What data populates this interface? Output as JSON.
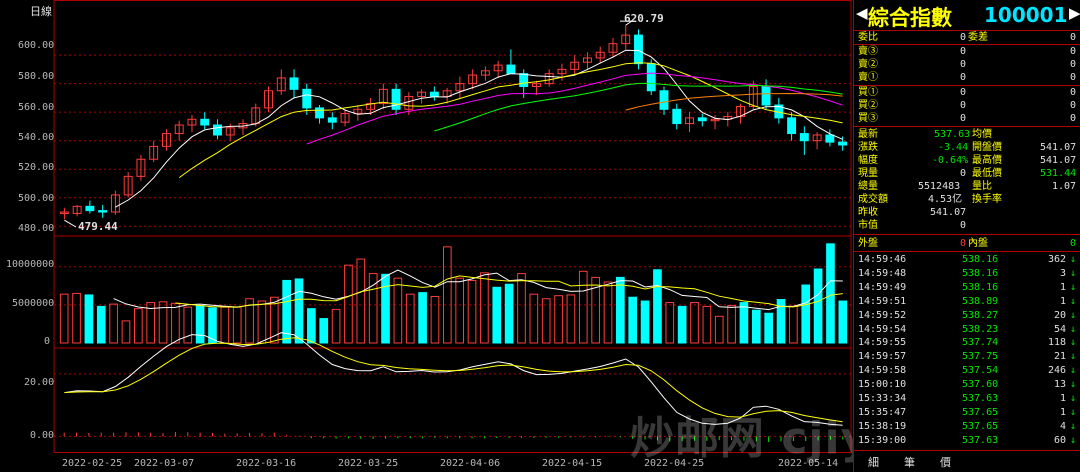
{
  "chart": {
    "period_label": "日線",
    "price_axis_ticks": [
      "600.00",
      "580.00",
      "560.00",
      "540.00",
      "520.00",
      "500.00",
      "480.00"
    ],
    "high_label": "620.79",
    "low_label": "479.44",
    "volume_axis_ticks": [
      "10000000",
      "5000000",
      "0"
    ],
    "indicator_axis_ticks": [
      "20.00",
      "0.00"
    ],
    "date_labels": [
      "2022-02-25",
      "2022-03-07",
      "2022-03-16",
      "2022-03-25",
      "2022-04-06",
      "2022-04-15",
      "2022-04-25",
      "2022-05-14"
    ]
  },
  "chart_data": {
    "type": "candlestick",
    "price_range": [
      476,
      626
    ],
    "candles": [
      [
        489,
        493,
        485,
        490
      ],
      [
        489,
        495,
        487,
        494
      ],
      [
        494,
        498,
        489,
        491
      ],
      [
        491,
        495,
        486,
        490
      ],
      [
        490,
        505,
        488,
        502
      ],
      [
        502,
        518,
        500,
        515
      ],
      [
        515,
        530,
        512,
        527
      ],
      [
        527,
        540,
        525,
        536
      ],
      [
        536,
        548,
        533,
        545
      ],
      [
        545,
        554,
        540,
        551
      ],
      [
        551,
        558,
        546,
        555
      ],
      [
        555,
        560,
        548,
        551
      ],
      [
        551,
        555,
        541,
        544
      ],
      [
        544,
        552,
        540,
        549
      ],
      [
        549,
        555,
        544,
        552
      ],
      [
        552,
        566,
        550,
        563
      ],
      [
        563,
        578,
        560,
        575
      ],
      [
        575,
        590,
        572,
        584
      ],
      [
        584,
        590,
        570,
        576
      ],
      [
        576,
        580,
        558,
        563
      ],
      [
        563,
        565,
        552,
        556
      ],
      [
        556,
        560,
        548,
        553
      ],
      [
        553,
        562,
        550,
        559
      ],
      [
        559,
        565,
        554,
        562
      ],
      [
        562,
        570,
        558,
        566
      ],
      [
        566,
        580,
        562,
        576
      ],
      [
        576,
        580,
        558,
        562
      ],
      [
        562,
        574,
        558,
        571
      ],
      [
        571,
        576,
        566,
        574
      ],
      [
        574,
        578,
        568,
        571
      ],
      [
        571,
        577,
        566,
        575
      ],
      [
        575,
        585,
        570,
        580
      ],
      [
        580,
        590,
        576,
        586
      ],
      [
        586,
        592,
        582,
        589
      ],
      [
        589,
        596,
        584,
        593
      ],
      [
        593,
        604,
        590,
        587
      ],
      [
        587,
        590,
        570,
        578
      ],
      [
        578,
        582,
        572,
        580
      ],
      [
        580,
        590,
        578,
        587
      ],
      [
        587,
        594,
        582,
        590
      ],
      [
        590,
        600,
        586,
        595
      ],
      [
        595,
        602,
        590,
        598
      ],
      [
        598,
        606,
        594,
        602
      ],
      [
        602,
        612,
        598,
        608
      ],
      [
        608,
        621,
        604,
        614
      ],
      [
        614,
        618,
        590,
        594
      ],
      [
        594,
        597,
        572,
        575
      ],
      [
        575,
        578,
        558,
        562
      ],
      [
        562,
        566,
        548,
        552
      ],
      [
        552,
        560,
        546,
        556
      ],
      [
        556,
        559,
        550,
        554
      ],
      [
        554,
        558,
        548,
        555
      ],
      [
        555,
        560,
        550,
        557
      ],
      [
        557,
        566,
        552,
        564
      ],
      [
        564,
        582,
        562,
        578
      ],
      [
        578,
        583,
        562,
        565
      ],
      [
        565,
        570,
        552,
        556
      ],
      [
        556,
        560,
        540,
        545
      ],
      [
        545,
        550,
        530,
        540
      ],
      [
        540,
        546,
        534,
        544
      ],
      [
        544,
        548,
        536,
        539
      ],
      [
        539,
        543,
        533,
        537
      ]
    ],
    "volume_range": [
      0,
      13500000
    ],
    "volumes": [
      6400000,
      6500000,
      6300000,
      4800000,
      5100000,
      2900000,
      4500000,
      5300000,
      5400000,
      5200000,
      4700000,
      4900000,
      4600000,
      4700000,
      4700000,
      5800000,
      5500000,
      6000000,
      8200000,
      8400000,
      4500000,
      3200000,
      4400000,
      10200000,
      11000000,
      9100000,
      9000000,
      8500000,
      6400000,
      6600000,
      6100000,
      12600000,
      8500000,
      8200000,
      9200000,
      7300000,
      7700000,
      9100000,
      6400000,
      5800000,
      6200000,
      6300000,
      9400000,
      8600000,
      8000000,
      8600000,
      6000000,
      5500000,
      9600000,
      5300000,
      4800000,
      5300000,
      4800000,
      3500000,
      4900000,
      5300000,
      4300000,
      3900000,
      5700000,
      4800000,
      7600000,
      9700000,
      13000000,
      5500000
    ],
    "indicator_range": [
      -5,
      27
    ],
    "indicator_bars": [
      1.2,
      1.2,
      1.1,
      1.2,
      1.2,
      1.3,
      1.3,
      1.2,
      1.1,
      1.4,
      1.3,
      1.2,
      1.1,
      0.9,
      0.9,
      1.1,
      1.0,
      1.2,
      0.5,
      0.2,
      -0.6,
      -0.6,
      -0.7,
      -0.6,
      -0.8,
      -0.8,
      -0.7,
      -0.6,
      -0.6,
      -0.6,
      -0.5,
      -0.6,
      -0.6,
      -0.6,
      -0.6,
      -0.5,
      -0.5,
      -0.5,
      -0.5,
      -0.4,
      -0.4,
      -0.4,
      -0.3,
      -0.3,
      -0.2,
      -0.3,
      -0.8,
      -1.0,
      -1.3,
      -1.6,
      -1.5,
      -1.4,
      -1.4,
      -1.2,
      -1.2,
      -1.4,
      -1.6,
      -1.8,
      -1.6,
      -1.5,
      -1.5,
      -1.3,
      -1.1,
      -1.0
    ]
  },
  "panel": {
    "title": "綜合指數",
    "code": "100001",
    "weibi_label": "委比",
    "weibi_value": "0",
    "weicha_label": "委差",
    "weicha_value": "0",
    "asks": [
      {
        "label": "賣③",
        "value": "0",
        "vol": "0"
      },
      {
        "label": "賣②",
        "value": "0",
        "vol": "0"
      },
      {
        "label": "賣①",
        "value": "0",
        "vol": "0"
      }
    ],
    "bids": [
      {
        "label": "買①",
        "value": "0",
        "vol": "0"
      },
      {
        "label": "買②",
        "value": "0",
        "vol": "0"
      },
      {
        "label": "買③",
        "value": "0",
        "vol": "0"
      }
    ],
    "stats": [
      {
        "l1": "最新",
        "v1": "537.63",
        "l2": "均價",
        "v2": ""
      },
      {
        "l1": "漲跌",
        "v1": "-3.44",
        "l2": "開盤價",
        "v2": "541.07"
      },
      {
        "l1": "幅度",
        "v1": "-0.64%",
        "l2": "最高價",
        "v2": "541.07"
      },
      {
        "l1": "現量",
        "v1": "0",
        "l2": "最低價",
        "v2": "531.44"
      },
      {
        "l1": "總量",
        "v1": "5512483",
        "l2": "量比",
        "v2": "1.07"
      },
      {
        "l1": "成交額",
        "v1": "4.53亿",
        "l2": "換手率",
        "v2": ""
      },
      {
        "l1": "昨收",
        "v1": "541.07",
        "l2": "",
        "v2": ""
      },
      {
        "l1": "市值",
        "v1": "0",
        "l2": "",
        "v2": ""
      }
    ],
    "outer_label": "外盤",
    "outer_value": "0",
    "inner_label": "內盤",
    "inner_value": "0",
    "ticks": [
      {
        "time": "14:59:46",
        "price": "538.16",
        "vol": "362"
      },
      {
        "time": "14:59:48",
        "price": "538.16",
        "vol": "3"
      },
      {
        "time": "14:59:49",
        "price": "538.16",
        "vol": "1"
      },
      {
        "time": "14:59:51",
        "price": "538.89",
        "vol": "1"
      },
      {
        "time": "14:59:52",
        "price": "538.27",
        "vol": "20"
      },
      {
        "time": "14:59:54",
        "price": "538.23",
        "vol": "54"
      },
      {
        "time": "14:59:55",
        "price": "537.74",
        "vol": "118"
      },
      {
        "time": "14:59:57",
        "price": "537.75",
        "vol": "21"
      },
      {
        "time": "14:59:58",
        "price": "537.54",
        "vol": "246"
      },
      {
        "time": "15:00:10",
        "price": "537.60",
        "vol": "13"
      },
      {
        "time": "15:33:34",
        "price": "537.63",
        "vol": "1"
      },
      {
        "time": "15:35:47",
        "price": "537.65",
        "vol": "1"
      },
      {
        "time": "15:38:19",
        "price": "537.65",
        "vol": "4"
      },
      {
        "time": "15:39:00",
        "price": "537.63",
        "vol": "60"
      }
    ],
    "tabs": [
      "細",
      "筆",
      "價"
    ],
    "arrow_glyph": "↓"
  },
  "watermark": "炒邮网 cjiyou.net",
  "colors": {
    "up": "#ff3c3c",
    "down": "#00ffff",
    "grid": "#b00000",
    "ma5": "#ffffff",
    "ma10": "#ffff00",
    "ma20": "#ff00ff",
    "ma30": "#00ff00",
    "ma60": "#ff8000"
  }
}
